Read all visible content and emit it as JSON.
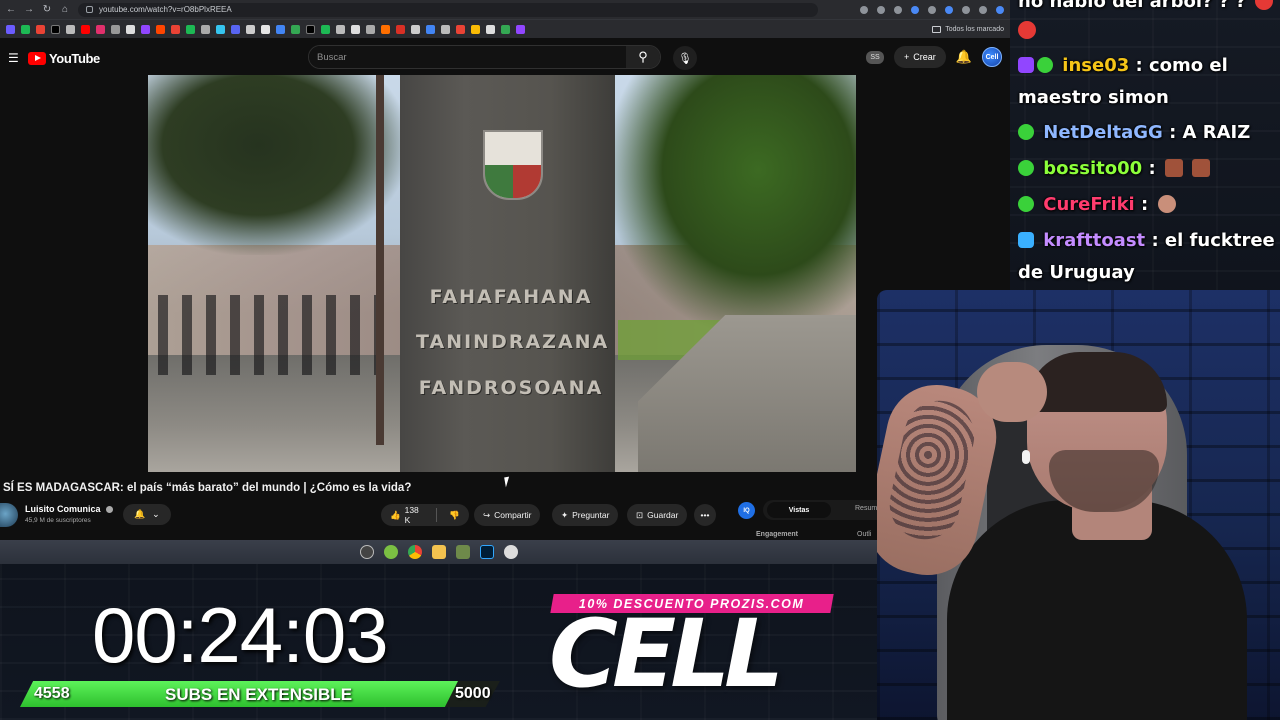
{
  "browser": {
    "url": "youtube.com/watch?v=rO8bPlxREEA",
    "bookmarks_folder": "Todos los marcado"
  },
  "youtube": {
    "logo": "YouTube",
    "search_placeholder": "Buscar",
    "ss_badge": "SS",
    "create_label": "Crear",
    "avatar_text": "Cell",
    "video": {
      "inscription": [
        "FAHAFAHANA",
        "TANINDRAZANA",
        "FANDROSOANA"
      ]
    },
    "title": "SÍ ES MADAGASCAR: el país “más barato” del mundo | ¿Cómo es la vida?",
    "channel": {
      "name": "Luisito Comunica",
      "subscribers": "45,9 M de suscriptores"
    },
    "actions": {
      "likes": "138 K",
      "share": "Compartir",
      "ask": "Preguntar",
      "save": "Guardar",
      "more": "•••"
    },
    "panel": {
      "logo": "IQ",
      "tab_active": "Vistas",
      "tab_other": "Resum",
      "engagement": "Engagement",
      "outline": "Outli"
    }
  },
  "chat": {
    "top_partial": "no habló del árbol? ? ?",
    "messages": [
      {
        "user": "inse03",
        "text": ": como el maestro simon",
        "color": "#f5c518"
      },
      {
        "user": "NetDeltaGG",
        "text": ": A RAIZ",
        "color": "#8fb7ff"
      },
      {
        "user": "bossito00",
        "text": ":",
        "color": "#8cff3a"
      },
      {
        "user": "CureFriki",
        "text": ":",
        "color": "#ff3c6e"
      },
      {
        "user": "krafttoast",
        "text": ": el fucktree de Uruguay",
        "color": "#c48cff"
      }
    ]
  },
  "overlay": {
    "timer": "00:24:03",
    "subs": {
      "current": "4558",
      "label": "SUBS EN EXTENSIBLE",
      "goal": "5000",
      "progress": 0.9116
    },
    "sponsor": {
      "promo": "10% DESCUENTO PROZIS.COM",
      "brand": "CELL"
    }
  },
  "colors": {
    "youtube_red": "#ff0000",
    "promo_pink": "#e8208a",
    "subs_green": "#3ad13a"
  }
}
